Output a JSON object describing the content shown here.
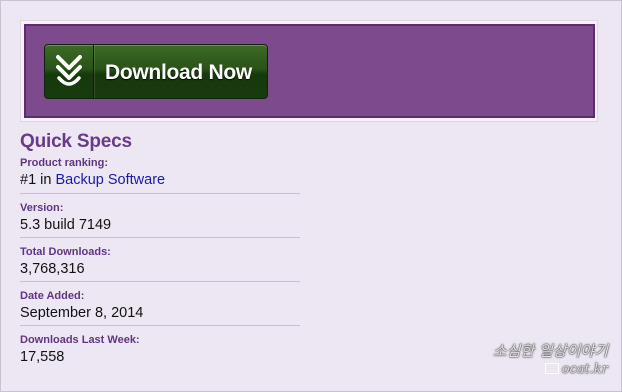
{
  "download": {
    "button_label": "Download Now",
    "icon": "download-arrow-icon"
  },
  "colors": {
    "banner": "#7d4b8d",
    "button": "#2a5318",
    "heading": "#6a3a8a",
    "link": "#1a1aa6"
  },
  "quick_specs": {
    "title": "Quick Specs",
    "ranking": {
      "label": "Product ranking:",
      "prefix": "#1 in",
      "link": "Backup Software"
    },
    "version": {
      "label": "Version:",
      "value": "5.3 build 7149"
    },
    "total_downloads": {
      "label": "Total Downloads:",
      "value": "3,768,316"
    },
    "date_added": {
      "label": "Date Added:",
      "value": "September 8, 2014"
    },
    "downloads_last_week": {
      "label": "Downloads Last Week:",
      "value": "17,558"
    }
  },
  "watermark": {
    "line1": "소심한 일상이야기",
    "line2": "ocat.kr"
  }
}
